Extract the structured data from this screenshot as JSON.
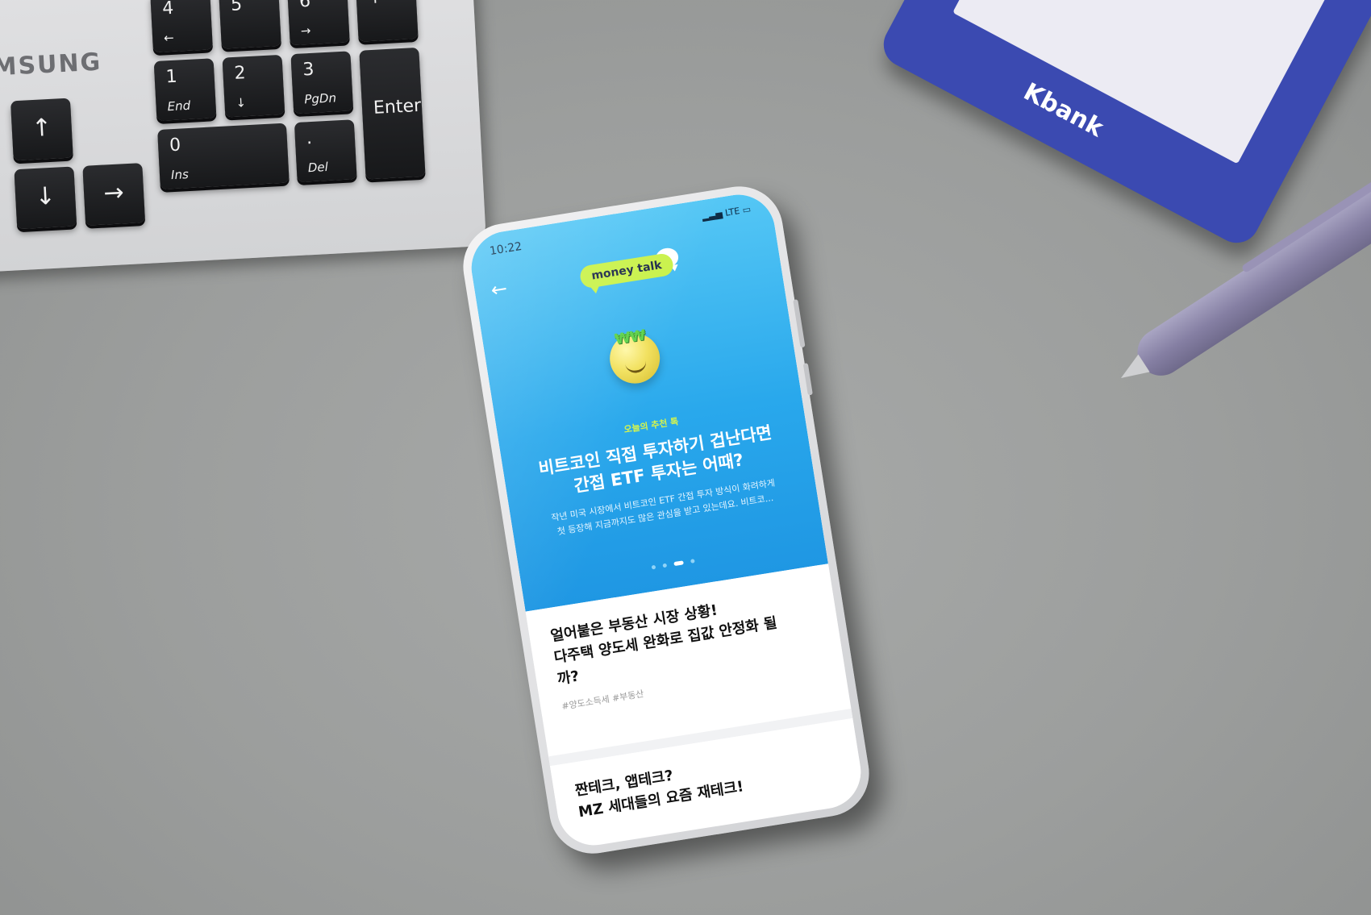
{
  "keyboard": {
    "brand": "MSUNG",
    "keys": {
      "k4": {
        "main": "4",
        "sub": "←"
      },
      "k5": {
        "main": "5"
      },
      "k6": {
        "main": "6",
        "sub": "→"
      },
      "plus": {
        "main": "+"
      },
      "k1": {
        "main": "1",
        "sub": "End"
      },
      "k2": {
        "main": "2",
        "sub": "↓"
      },
      "k3": {
        "main": "3",
        "sub": "PgDn"
      },
      "enter": {
        "main": "Enter"
      },
      "up": {
        "main": "↑"
      },
      "k0": {
        "main": "0",
        "sub": "Ins"
      },
      "del": {
        "main": ".",
        "sub": "Del"
      },
      "down": {
        "main": "↓"
      },
      "right": {
        "main": "→"
      }
    }
  },
  "notepad": {
    "logo": "Kbank",
    "color": "#3b4ab1"
  },
  "phone": {
    "status": {
      "time": "10:22",
      "network": "LTE"
    },
    "header": {
      "back_icon": "←",
      "logo_text": "money talk"
    },
    "hero": {
      "tag": "오늘의 추천 톡",
      "headline": [
        "비트코인 직접 투자하기 겁난다면",
        "간접 ETF 투자는 어때?"
      ],
      "summary": [
        "작년 미국 시장에서 비트코인 ETF 간접 투자 방식이 화려하게",
        "첫 등장해 지금까지도 많은 관심을 받고 있는데요. 비트코..."
      ],
      "emoji_text": "₩₩",
      "carousel": {
        "count": 4,
        "active": 2
      },
      "color": "#29a8ec",
      "accent": "#c9f24a"
    },
    "cards": [
      {
        "title": [
          "얼어붙은 부동산 시장 상황!",
          "다주택 양도세 완화로 집값 안정화 될",
          "까?"
        ],
        "hashtags": "#양도소득세 #부동산"
      },
      {
        "title": [
          "짠테크, 앱테크?",
          "MZ 세대들의 요즘 재테크!"
        ],
        "hashtags": ""
      }
    ]
  }
}
